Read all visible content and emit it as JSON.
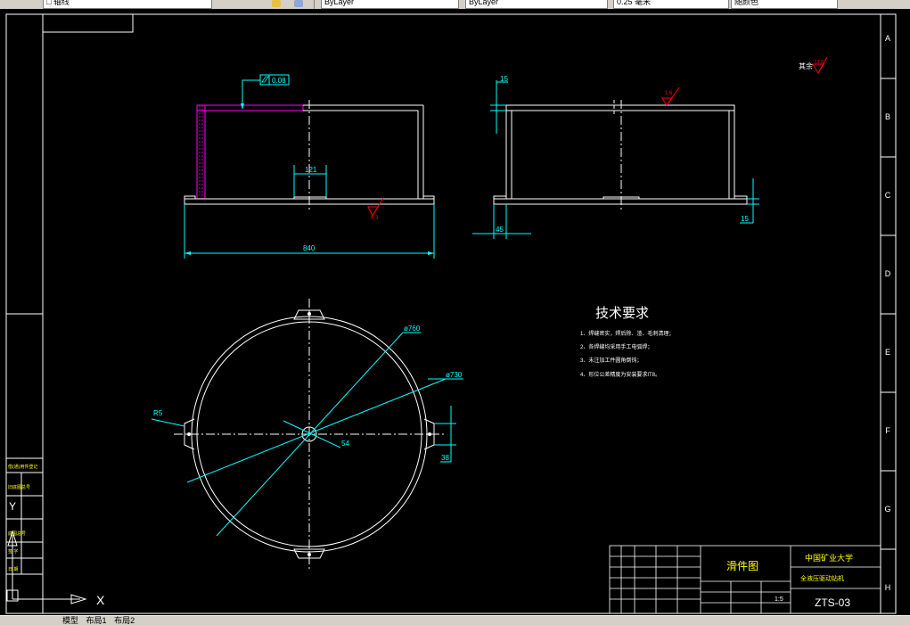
{
  "toolbar": {
    "layer_field": "□ 轴线",
    "color_field": "ByLayer",
    "linetype_field": "ByLayer",
    "lineweight_field": "0.25 毫米",
    "plotstyle_field": "随颜色"
  },
  "drawing": {
    "zone_letters": [
      "A",
      "B",
      "C",
      "D",
      "E",
      "F",
      "G",
      "H"
    ],
    "dims": {
      "flatness": "0.08",
      "d121": "121",
      "d840": "840",
      "d15_top": "15",
      "d15_side": "15",
      "d45": "45",
      "phi760": "ø760",
      "phi730": "ø730",
      "r5": "R5",
      "d54": "54",
      "d38": "38"
    },
    "roughness": {
      "r63": "6.3",
      "r16": "1.6",
      "rest_label": "其余",
      "rest_value": "12.5"
    },
    "tech": {
      "title": "技术要求",
      "items": [
        "1、焊缝密实，焊后除、渣、毛刺清理；",
        "2、各焊缝均采用手工电弧焊；",
        "3、未注加工件圆角倒钝；",
        "4、形位公差精度为安装要求IT8。"
      ]
    },
    "title_block": {
      "part_name": "滑件图",
      "university": "中国矿业大学",
      "project": "全液压驱动钻机",
      "drawing_no": "ZTS-03",
      "scale": "1:5"
    },
    "ucs": {
      "y": "Y",
      "x": "X"
    },
    "left_strip": [
      "借(通)用件登记",
      "旧底图总号",
      "底图总号",
      "签  字",
      "日  期"
    ]
  },
  "status": {
    "tabs": [
      "模型",
      "布局1",
      "布局2"
    ]
  }
}
